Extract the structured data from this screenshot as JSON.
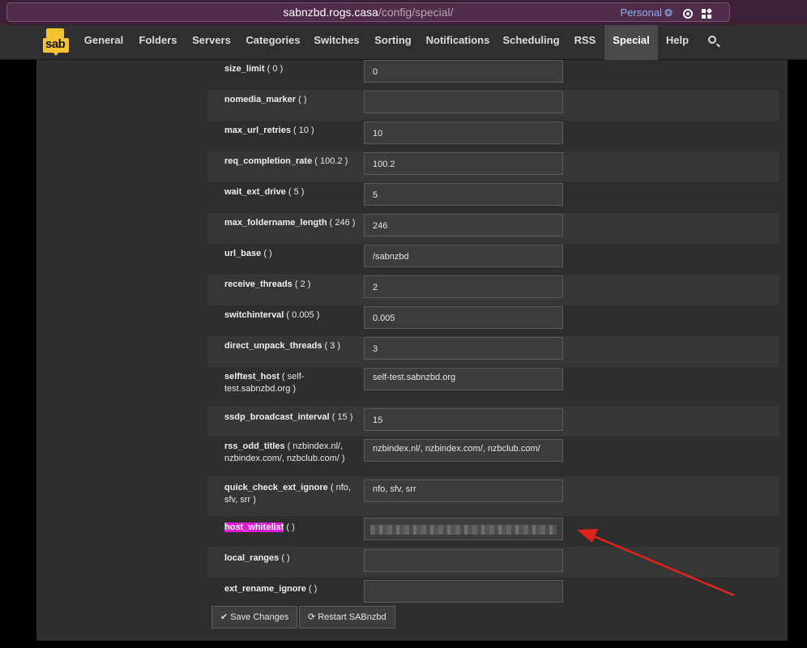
{
  "browser": {
    "url_host": "sabnzbd.rogs.casa",
    "url_path": "/config/special/",
    "url_prefix": "",
    "profile": "Personal"
  },
  "nav": {
    "logo": "sab",
    "items": [
      "General",
      "Folders",
      "Servers",
      "Categories",
      "Switches",
      "Sorting",
      "Notifications",
      "Scheduling",
      "RSS",
      "Special",
      "Help"
    ],
    "active": "Special"
  },
  "settings": [
    {
      "key": "size_limit",
      "default": "( 0 )",
      "value": "0"
    },
    {
      "key": "nomedia_marker",
      "default": "(  )",
      "value": ""
    },
    {
      "key": "max_url_retries",
      "default": "( 10 )",
      "value": "10"
    },
    {
      "key": "req_completion_rate",
      "default": "( 100.2 )",
      "value": "100.2"
    },
    {
      "key": "wait_ext_drive",
      "default": "( 5 )",
      "value": "5"
    },
    {
      "key": "max_foldername_length",
      "default": "( 246 )",
      "value": "246"
    },
    {
      "key": "url_base",
      "default": "(  )",
      "value": "/sabnzbd"
    },
    {
      "key": "receive_threads",
      "default": "( 2 )",
      "value": "2"
    },
    {
      "key": "switchinterval",
      "default": "( 0.005 )",
      "value": "0.005"
    },
    {
      "key": "direct_unpack_threads",
      "default": "( 3 )",
      "value": "3"
    },
    {
      "key": "selftest_host",
      "default": "( self-test.sabnzbd.org )",
      "value": "self-test.sabnzbd.org"
    },
    {
      "key": "ssdp_broadcast_interval",
      "default": "( 15 )",
      "value": "15"
    },
    {
      "key": "rss_odd_titles",
      "default": "( nzbindex.nl/, nzbindex.com/, nzbclub.com/ )",
      "value": "nzbindex.nl/, nzbindex.com/, nzbclub.com/"
    },
    {
      "key": "quick_check_ext_ignore",
      "default": "( nfo, sfv, srr )",
      "value": "nfo, sfv, srr"
    },
    {
      "key": "host_whitelist",
      "default": "(  )",
      "value": ""
    },
    {
      "key": "local_ranges",
      "default": "(  )",
      "value": ""
    },
    {
      "key": "ext_rename_ignore",
      "default": "(  )",
      "value": ""
    }
  ],
  "buttons": {
    "save": "Save Changes",
    "restart": "Restart SABnzbd"
  },
  "colors": {
    "highlight": "#e11ad9",
    "arrow": "#e0241c",
    "logo": "#f4c430"
  }
}
